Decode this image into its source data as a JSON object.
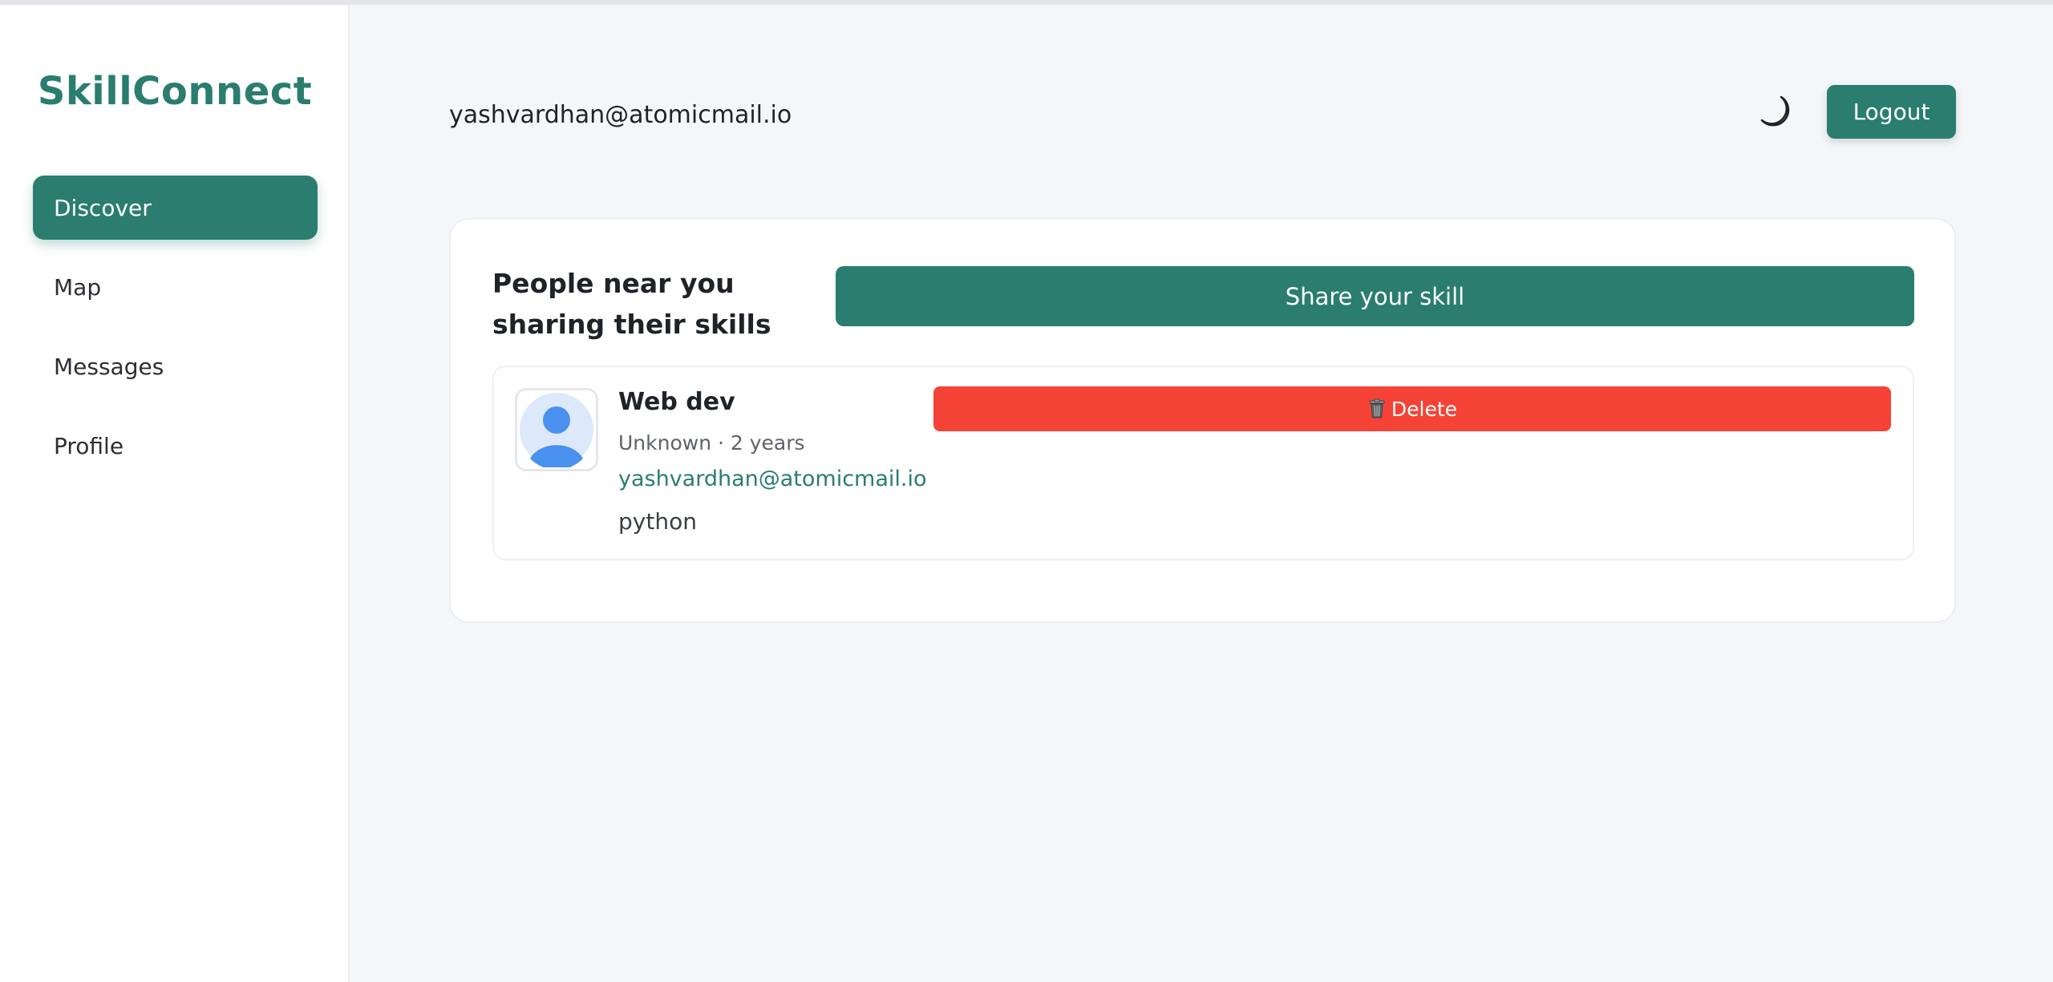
{
  "sidebar": {
    "brand": "SkillConnect",
    "items": [
      {
        "label": "Discover",
        "active": true
      },
      {
        "label": "Map",
        "active": false
      },
      {
        "label": "Messages",
        "active": false
      },
      {
        "label": "Profile",
        "active": false
      }
    ]
  },
  "header": {
    "user_email": "yashvardhan@atomicmail.io",
    "theme_icon": "moon-icon",
    "logout_label": "Logout"
  },
  "main": {
    "heading": "People near you sharing their skills",
    "share_label": "Share your skill",
    "skills": [
      {
        "title": "Web dev",
        "meta": "Unknown · 2 years",
        "email": "yashvardhan@atomicmail.io",
        "tag": "python",
        "avatar_icon": "user-avatar-icon",
        "delete_label": "Delete",
        "delete_icon": "trash-icon"
      }
    ]
  },
  "colors": {
    "accent": "#2a7d6f",
    "danger": "#f44336",
    "background": "#f5f6fa",
    "surface": "#ffffff"
  }
}
